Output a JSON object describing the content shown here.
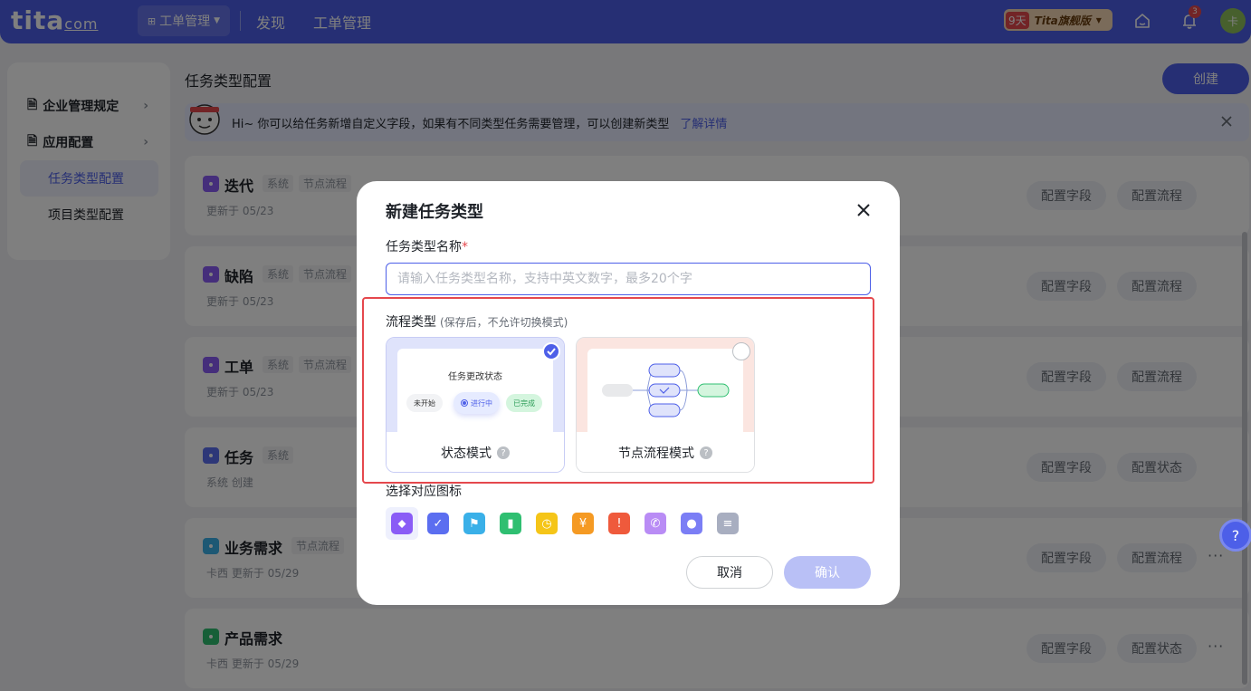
{
  "topbar": {
    "logo": "tita",
    "logo_suffix": "com",
    "app_switch_label": "工单管理",
    "nav": [
      "发现",
      "工单管理"
    ],
    "trial_days": "9天",
    "plan_label": "Tita旗舰版",
    "notification_count": "3",
    "avatar_text": "卡"
  },
  "sidebar": {
    "groups": [
      "企业管理规定",
      "应用配置"
    ],
    "items": [
      "任务类型配置",
      "项目类型配置"
    ]
  },
  "page": {
    "title": "任务类型配置",
    "create_label": "创建"
  },
  "banner": {
    "text": "Hi~ 你可以给任务新增自定义字段，如果有不同类型任务需要管理，可以创建新类型",
    "link": "了解详情"
  },
  "cards": [
    {
      "name": "迭代",
      "tags": [
        "系统",
        "节点流程"
      ],
      "meta": "更新于 05/23",
      "buttons": [
        "配置字段",
        "配置流程"
      ],
      "more": false,
      "color": "#8a5cf6"
    },
    {
      "name": "缺陷",
      "tags": [
        "系统",
        "节点流程"
      ],
      "meta": "更新于 05/23",
      "buttons": [
        "配置字段",
        "配置流程"
      ],
      "more": false,
      "color": "#8a5cf6"
    },
    {
      "name": "工单",
      "tags": [
        "系统",
        "节点流程"
      ],
      "meta": "更新于 05/23",
      "buttons": [
        "配置字段",
        "配置流程"
      ],
      "more": false,
      "color": "#8a5cf6"
    },
    {
      "name": "任务",
      "tags": [
        "系统"
      ],
      "meta": "系统 创建",
      "buttons": [
        "配置字段",
        "配置状态"
      ],
      "more": false,
      "color": "#5b6ef0"
    },
    {
      "name": "业务需求",
      "tags": [
        "节点流程"
      ],
      "meta": "卡西 更新于 05/29",
      "buttons": [
        "配置字段",
        "配置流程"
      ],
      "more": true,
      "color": "#3ab0e8"
    },
    {
      "name": "产品需求",
      "tags": [],
      "meta": "卡西 更新于 05/29",
      "buttons": [
        "配置字段",
        "配置状态"
      ],
      "more": true,
      "color": "#2fbf71"
    }
  ],
  "modal": {
    "title": "新建任务类型",
    "name_label": "任务类型名称",
    "required_mark": "*",
    "name_placeholder": "请输入任务类型名称，支持中英文数字，最多20个字",
    "name_value": "",
    "flow_label": "流程类型",
    "flow_hint": "(保存后，不允许切换模式)",
    "modes": [
      {
        "label": "状态模式",
        "selected": true
      },
      {
        "label": "节点流程模式",
        "selected": false
      }
    ],
    "status_preview": {
      "title": "任务更改状态",
      "chips": [
        "未开始",
        "进行中",
        "已完成"
      ]
    },
    "icon_label": "选择对应图标",
    "icons": [
      {
        "name": "tag-icon",
        "color": "#8a5cf6",
        "selected": true
      },
      {
        "name": "check-circle-icon",
        "color": "#5b6ef0",
        "selected": false
      },
      {
        "name": "flag-icon",
        "color": "#3ab0e8",
        "selected": false
      },
      {
        "name": "bars-icon",
        "color": "#2fbf71",
        "selected": false
      },
      {
        "name": "clock-icon",
        "color": "#f5c518",
        "selected": false
      },
      {
        "name": "yen-icon",
        "color": "#f59a23",
        "selected": false
      },
      {
        "name": "alert-icon",
        "color": "#ef5a3c",
        "selected": false
      },
      {
        "name": "phone-icon",
        "color": "#b98cf5",
        "selected": false
      },
      {
        "name": "person-icon",
        "color": "#7b7ef5",
        "selected": false
      },
      {
        "name": "layers-icon",
        "color": "#a8aec0",
        "selected": false
      }
    ],
    "cancel_label": "取消",
    "confirm_label": "确认"
  }
}
